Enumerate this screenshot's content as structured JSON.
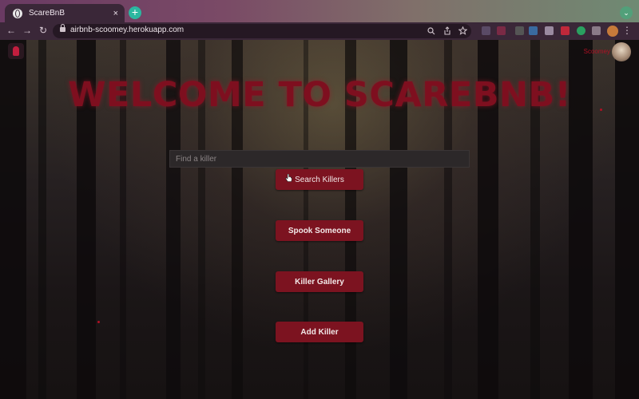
{
  "browser": {
    "tab_title": "ScareBnB",
    "tab_close": "×",
    "new_tab": "+",
    "tab_menu": "⌄",
    "url": "airbnb-scoomey.herokuapp.com",
    "back": "←",
    "forward": "→",
    "reload": "↻",
    "menu": "⋮"
  },
  "page": {
    "heading": "WELCOME TO SCAREBNB!",
    "nav_username": "Scoomey",
    "search": {
      "placeholder": "Find a killer",
      "value": ""
    },
    "buttons": {
      "search": "Search Killers",
      "spook": "Spook Someone",
      "gallery": "Killer Gallery",
      "add": "Add Killer"
    }
  },
  "colors": {
    "accent": "#7c1320",
    "heading": "#7e0f1f",
    "chrome": "#3a2738"
  }
}
